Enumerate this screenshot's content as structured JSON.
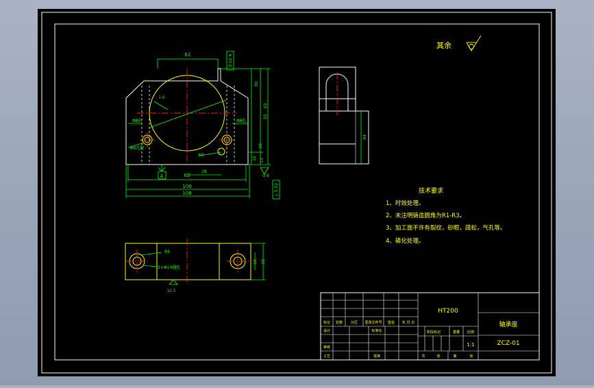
{
  "drawing": {
    "surface_finish_note": "其余",
    "tech_req": {
      "title": "技术要求",
      "items": [
        "1、时效处理。",
        "2、未注明铸造圆角为R1-R3。",
        "3、加工面不许有裂纹，砂眼，疏松，气孔等。",
        "4、磷化处理。"
      ]
    },
    "dims": {
      "top_width": "62",
      "circle_dia": "Φ60",
      "parallel_tol": "0.02 A",
      "overall_height": "80",
      "height_63": "63",
      "height_50": "50",
      "height_20": "20",
      "height_10": "10",
      "height_13": "13",
      "mid_width": "62",
      "base_100": "100",
      "base_108": "108",
      "dim_28": "28",
      "hole_m5": "M5",
      "hole_label_left": "Φ8孔",
      "hole_label_right": "Φ8孔",
      "hole_label_bottom": "Φ8孔配",
      "rough_16": "1.6",
      "rough_08": "0.8",
      "datum_a": "A",
      "perp_tol": "⊥ 0.02",
      "plan_r8": "R8",
      "plan_holes": "2×Φ10通孔",
      "plan_dim_18": "18",
      "plan_dim_28": "28",
      "plan_rough": "12.5",
      "side_dim_44": "44"
    },
    "title_block": {
      "material": "HT200",
      "part_name": "轴承座",
      "drawing_no": "ZCZ-01",
      "scale": "1:1",
      "row_labels": [
        "标记",
        "处数",
        "分区",
        "更改文件号",
        "签名",
        "年.月.日"
      ],
      "designer": "设计",
      "standardization": "标准化",
      "checker": "审核",
      "process": "工艺",
      "approval": "批准",
      "stage_mark": "阶段标记",
      "weight": "重量",
      "ratio": "比例",
      "sheet_total": "共",
      "sheet_word": "张",
      "sheet_no": "第",
      "sheet_word2": "张"
    }
  }
}
